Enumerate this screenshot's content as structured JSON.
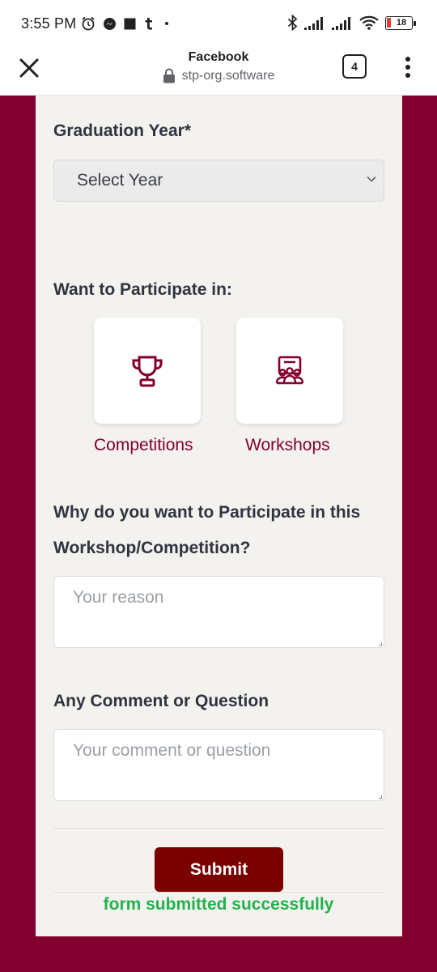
{
  "status_bar": {
    "time": "3:55 PM",
    "battery": "18"
  },
  "browser": {
    "site_title": "Facebook",
    "url": "stp-org.software",
    "tab_count": "4"
  },
  "form": {
    "graduation_year": {
      "label": "Graduation Year*",
      "selected": "Select Year"
    },
    "participate": {
      "label": "Want to Participate in:",
      "options": [
        {
          "label": "Competitions",
          "icon": "trophy-icon"
        },
        {
          "label": "Workshops",
          "icon": "workshop-group-icon"
        }
      ]
    },
    "reason": {
      "label_line1": "Why do you want to Participate in this",
      "label_line2": "Workshop/Competition?",
      "placeholder": "Your reason"
    },
    "comment": {
      "label": "Any Comment or Question",
      "placeholder": "Your comment or question"
    },
    "submit_label": "Submit",
    "success_message": "form submitted successfully"
  },
  "colors": {
    "brand_maroon": "#82002d",
    "submit_bg": "#7a0000",
    "success_green": "#22b14c",
    "card_bg": "#f4f2ee"
  }
}
